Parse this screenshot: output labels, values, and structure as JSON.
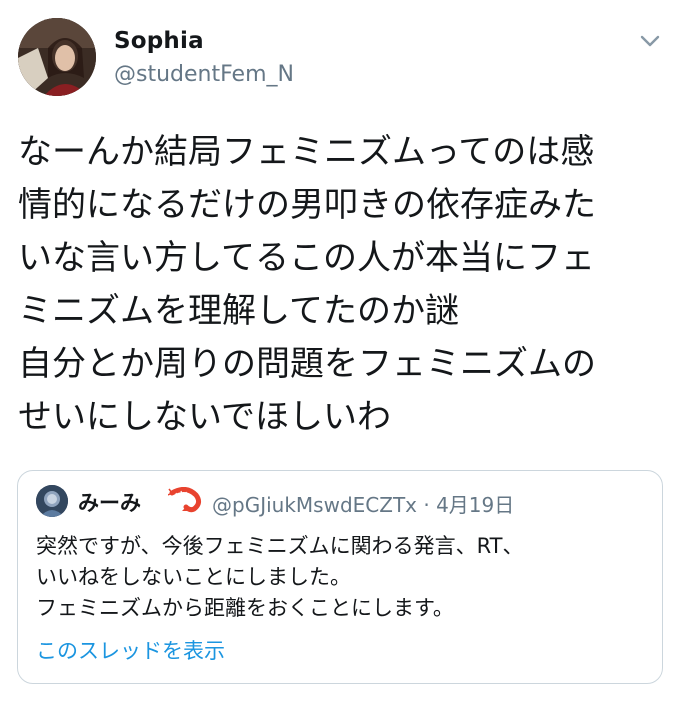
{
  "author": {
    "display_name": "Sophia",
    "handle": "@studentFem_N"
  },
  "menu": {
    "icon": "chevron-down-icon"
  },
  "tweet": {
    "text": "なーんか結局フェミニズムってのは感\n情的になるだけの男叩きの依存症みた\nいな言い方してるこの人が本当にフェ\nミニズムを理解してたのか謎\n自分とか周りの問題をフェミニズムの\nせいにしないでほしいわ"
  },
  "quoted": {
    "display_name": "みーみ",
    "emoji_icon": "shrimp-icon",
    "handle_date": "@pGJiukMswdECZTx · 4月19日",
    "text": "突然ですが、今後フェミニズムに関わる発言、RT、\nいいねをしないことにしました。\nフェミニズムから距離をおくことにします。",
    "show_thread": "このスレッドを表示"
  },
  "colors": {
    "text": "#14171a",
    "secondary": "#657786",
    "link": "#1b95e0",
    "border": "#ccd6dd",
    "shrimp": "#e8432f"
  }
}
